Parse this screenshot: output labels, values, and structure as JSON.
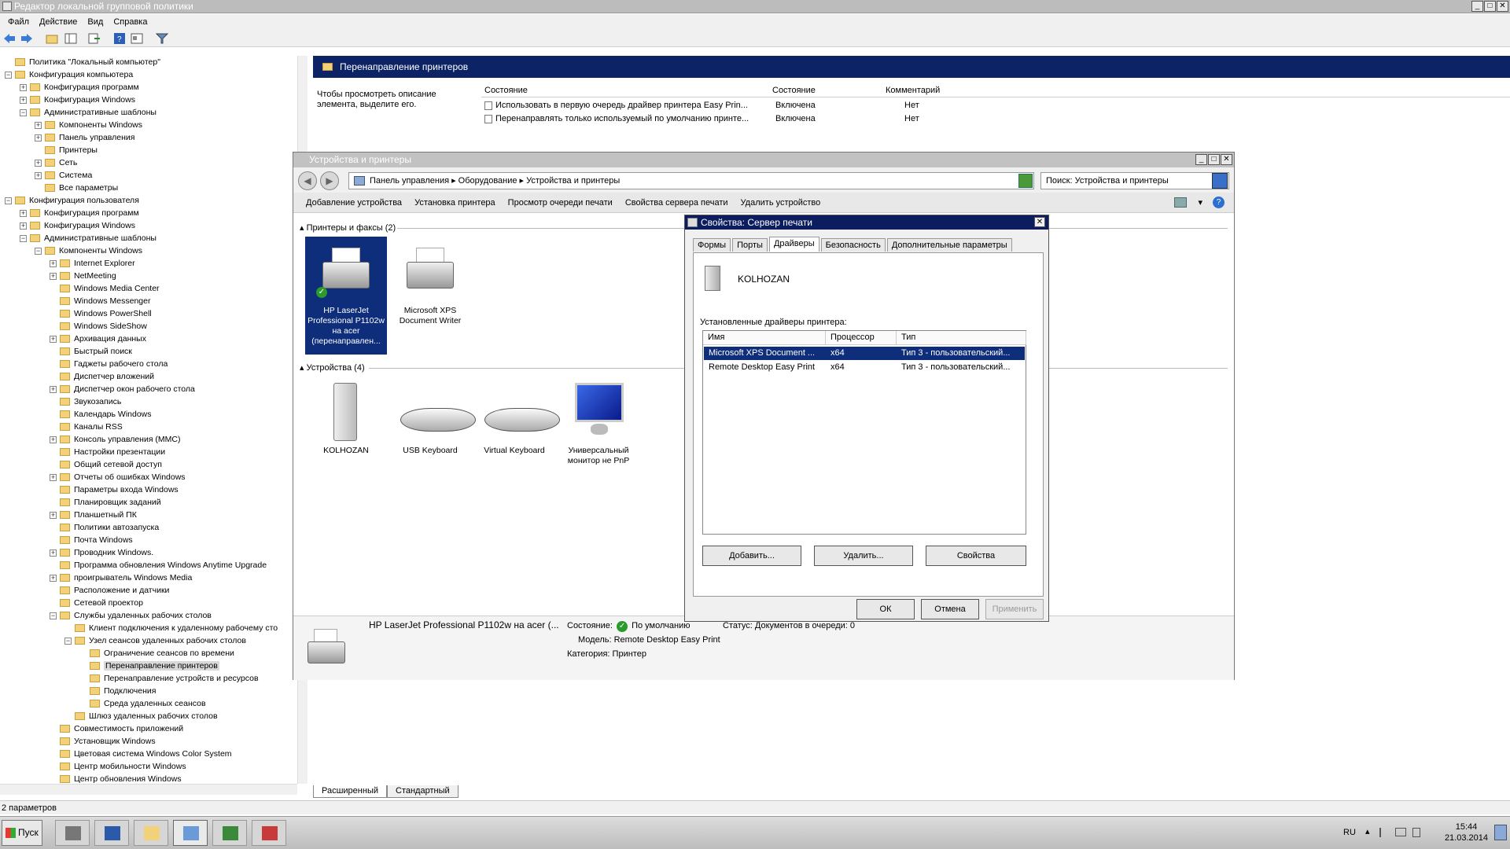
{
  "main": {
    "title": "Редактор локальной групповой политики",
    "menu": [
      "Файл",
      "Действие",
      "Вид",
      "Справка"
    ]
  },
  "tree": {
    "items": [
      {
        "label": "Политика \"Локальный компьютер\"",
        "level": 0,
        "exp": ""
      },
      {
        "label": "Конфигурация компьютера",
        "level": 0,
        "exp": "-"
      },
      {
        "label": "Конфигурация программ",
        "level": 1,
        "exp": "+"
      },
      {
        "label": "Конфигурация Windows",
        "level": 1,
        "exp": "+"
      },
      {
        "label": "Административные шаблоны",
        "level": 1,
        "exp": "-"
      },
      {
        "label": "Компоненты Windows",
        "level": 2,
        "exp": "+"
      },
      {
        "label": "Панель управления",
        "level": 2,
        "exp": "+"
      },
      {
        "label": "Принтеры",
        "level": 2,
        "exp": ""
      },
      {
        "label": "Сеть",
        "level": 2,
        "exp": "+"
      },
      {
        "label": "Система",
        "level": 2,
        "exp": "+"
      },
      {
        "label": "Все параметры",
        "level": 2,
        "exp": ""
      },
      {
        "label": "Конфигурация пользователя",
        "level": 0,
        "exp": "-"
      },
      {
        "label": "Конфигурация программ",
        "level": 1,
        "exp": "+"
      },
      {
        "label": "Конфигурация Windows",
        "level": 1,
        "exp": "+"
      },
      {
        "label": "Административные шаблоны",
        "level": 1,
        "exp": "-"
      },
      {
        "label": "Компоненты Windows",
        "level": 2,
        "exp": "-"
      },
      {
        "label": "Internet Explorer",
        "level": 3,
        "exp": "+"
      },
      {
        "label": "NetMeeting",
        "level": 3,
        "exp": "+"
      },
      {
        "label": "Windows Media Center",
        "level": 3,
        "exp": ""
      },
      {
        "label": "Windows Messenger",
        "level": 3,
        "exp": ""
      },
      {
        "label": "Windows PowerShell",
        "level": 3,
        "exp": ""
      },
      {
        "label": "Windows SideShow",
        "level": 3,
        "exp": ""
      },
      {
        "label": "Архивация данных",
        "level": 3,
        "exp": "+"
      },
      {
        "label": "Быстрый поиск",
        "level": 3,
        "exp": ""
      },
      {
        "label": "Гаджеты рабочего стола",
        "level": 3,
        "exp": ""
      },
      {
        "label": "Диспетчер вложений",
        "level": 3,
        "exp": ""
      },
      {
        "label": "Диспетчер окон рабочего стола",
        "level": 3,
        "exp": "+"
      },
      {
        "label": "Звукозапись",
        "level": 3,
        "exp": ""
      },
      {
        "label": "Календарь Windows",
        "level": 3,
        "exp": ""
      },
      {
        "label": "Каналы RSS",
        "level": 3,
        "exp": ""
      },
      {
        "label": "Консоль управления (MMC)",
        "level": 3,
        "exp": "+"
      },
      {
        "label": "Настройки презентации",
        "level": 3,
        "exp": ""
      },
      {
        "label": "Общий сетевой доступ",
        "level": 3,
        "exp": ""
      },
      {
        "label": "Отчеты об ошибках Windows",
        "level": 3,
        "exp": "+"
      },
      {
        "label": "Параметры входа Windows",
        "level": 3,
        "exp": ""
      },
      {
        "label": "Планировщик заданий",
        "level": 3,
        "exp": ""
      },
      {
        "label": "Планшетный ПК",
        "level": 3,
        "exp": "+"
      },
      {
        "label": "Политики автозапуска",
        "level": 3,
        "exp": ""
      },
      {
        "label": "Почта Windows",
        "level": 3,
        "exp": ""
      },
      {
        "label": "Проводник Windows.",
        "level": 3,
        "exp": "+"
      },
      {
        "label": "Программа обновления Windows Anytime Upgrade",
        "level": 3,
        "exp": ""
      },
      {
        "label": "проигрыватель Windows Media",
        "level": 3,
        "exp": "+"
      },
      {
        "label": "Расположение и датчики",
        "level": 3,
        "exp": ""
      },
      {
        "label": "Сетевой проектор",
        "level": 3,
        "exp": ""
      },
      {
        "label": "Службы удаленных рабочих столов",
        "level": 3,
        "exp": "-"
      },
      {
        "label": "Клиент подключения к удаленному рабочему сто",
        "level": 4,
        "exp": ""
      },
      {
        "label": "Узел сеансов удаленных рабочих столов",
        "level": 4,
        "exp": "-"
      },
      {
        "label": "Ограничение сеансов по времени",
        "level": 5,
        "exp": ""
      },
      {
        "label": "Перенаправление принтеров",
        "level": 5,
        "exp": "",
        "selected": true
      },
      {
        "label": "Перенаправление устройств и ресурсов",
        "level": 5,
        "exp": ""
      },
      {
        "label": "Подключения",
        "level": 5,
        "exp": ""
      },
      {
        "label": "Среда удаленных сеансов",
        "level": 5,
        "exp": ""
      },
      {
        "label": "Шлюз удаленных рабочих столов",
        "level": 4,
        "exp": ""
      },
      {
        "label": "Совместимость приложений",
        "level": 3,
        "exp": ""
      },
      {
        "label": "Установщик Windows",
        "level": 3,
        "exp": ""
      },
      {
        "label": "Цветовая система Windows Color System",
        "level": 3,
        "exp": ""
      },
      {
        "label": "Центр мобильности Windows",
        "level": 3,
        "exp": ""
      },
      {
        "label": "Центр обновления Windows",
        "level": 3,
        "exp": ""
      }
    ]
  },
  "right": {
    "header": "Перенаправление принтеров",
    "description": "Чтобы просмотреть описание элемента, выделите его.",
    "columns": {
      "state": "Состояние",
      "state2": "Состояние",
      "comment": "Комментарий"
    },
    "rows": [
      {
        "name": "Использовать в первую очередь драйвер принтера Easy Prin...",
        "state": "Включена",
        "comment": "Нет"
      },
      {
        "name": "Перенаправлять только используемый по умолчанию принте...",
        "state": "Включена",
        "comment": "Нет"
      }
    ],
    "tabs": {
      "extended": "Расширенный",
      "standard": "Стандартный"
    }
  },
  "status": {
    "text": "2 параметров"
  },
  "devices": {
    "title": "Устройства и принтеры",
    "breadcrumb": "Панель управления  ▸  Оборудование  ▸  Устройства и принтеры",
    "search": "Поиск: Устройства и принтеры",
    "commands": [
      "Добавление устройства",
      "Установка принтера",
      "Просмотр очереди печати",
      "Свойства сервера печати",
      "Удалить устройство"
    ],
    "group_printers": "Принтеры и факсы (2)",
    "group_devices": "Устройства (4)",
    "printers": [
      {
        "label": "HP LaserJet Professional P1102w на acer (перенаправлен...",
        "icon": "printer-icon"
      },
      {
        "label": "Microsoft XPS Document Writer",
        "icon": "printer-icon"
      }
    ],
    "devs": [
      {
        "label": "KOLHOZAN",
        "icon": "computer-tower-icon"
      },
      {
        "label": "USB Keyboard",
        "icon": "keyboard-icon"
      },
      {
        "label": "Virtual Keyboard",
        "icon": "keyboard-icon"
      },
      {
        "label": "Универсальный монитор не PnP",
        "icon": "monitor-icon"
      }
    ],
    "details": {
      "name": "HP LaserJet Professional P1102w на acer (...",
      "state_label": "Состояние:",
      "state_value": "По умолчанию",
      "status_label": "Статус:",
      "status_value": "Документов в очереди: 0",
      "model_label": "Модель:",
      "model_value": "Remote Desktop Easy Print",
      "category_label": "Категория:",
      "category_value": "Принтер"
    }
  },
  "dialog": {
    "title": "Свойства: Сервер печати",
    "tabs": [
      "Формы",
      "Порты",
      "Драйверы",
      "Безопасность",
      "Дополнительные параметры"
    ],
    "server": "KOLHOZAN",
    "installed_label": "Установленные драйверы принтера:",
    "columns": {
      "name": "Имя",
      "cpu": "Процессор",
      "type": "Тип"
    },
    "rows": [
      {
        "name": "Microsoft XPS Document ...",
        "cpu": "x64",
        "type": "Тип 3 - пользовательский..."
      },
      {
        "name": "Remote Desktop Easy Print",
        "cpu": "x64",
        "type": "Тип 3 - пользовательский..."
      }
    ],
    "buttons": {
      "add": "Добавить...",
      "remove": "Удалить...",
      "props": "Свойства",
      "ok": "ОК",
      "cancel": "Отмена",
      "apply": "Применить"
    }
  },
  "taskbar": {
    "start": "Пуск",
    "lang": "RU",
    "time": "15:44",
    "date": "21.03.2014"
  }
}
